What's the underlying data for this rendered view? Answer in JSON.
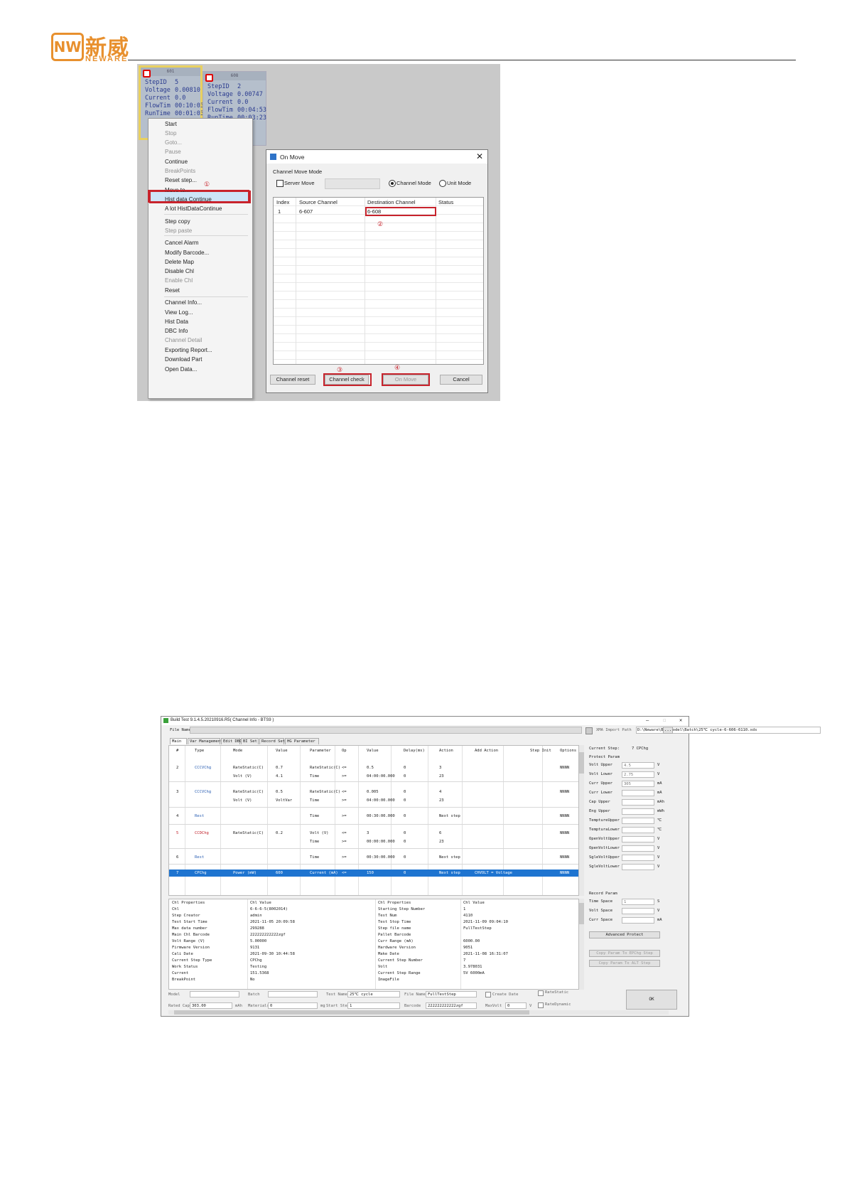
{
  "header": {
    "logo_mark": "NW",
    "logo_cn": "新威",
    "logo_en": "NEWARE"
  },
  "colors": {
    "brand": "#e8902e",
    "highlight": "#c8232c",
    "selection": "#1e74d0"
  },
  "shot1": {
    "tiles": [
      {
        "top": "601",
        "rows": [
          [
            "StepID",
            "5"
          ],
          [
            "Voltage",
            "0.00810"
          ],
          [
            "Current",
            "0.0"
          ],
          [
            "FlowTim",
            "00:10:03"
          ],
          [
            "RunTime",
            "00:01:03"
          ]
        ]
      },
      {
        "top": "608",
        "rows": [
          [
            "StepID",
            "2"
          ],
          [
            "Voltage",
            "0.00747"
          ],
          [
            "Current",
            "0.0"
          ],
          [
            "FlowTim",
            "00:04:53"
          ],
          [
            "RunTime",
            "00:03:23"
          ]
        ]
      }
    ],
    "menu": [
      {
        "label": "Start",
        "dis": false
      },
      {
        "label": "Stop",
        "dis": true
      },
      {
        "label": "Goto...",
        "dis": true
      },
      {
        "label": "Pause",
        "dis": true
      },
      {
        "label": "Continue",
        "dis": false
      },
      {
        "label": "BreakPoints",
        "dis": true
      },
      {
        "label": "Reset step...",
        "dis": false
      },
      {
        "label": "Move to...",
        "dis": false
      },
      {
        "label": "Hist data Continue",
        "dis": false
      },
      {
        "label": "A lot HistDataContinue",
        "dis": false
      },
      {
        "label": "Step copy",
        "dis": false
      },
      {
        "label": "Step paste",
        "dis": true
      },
      {
        "label": "Cancel Alarm",
        "dis": false
      },
      {
        "label": "Modify Barcode...",
        "dis": false
      },
      {
        "label": "Delete Map",
        "dis": false
      },
      {
        "label": "Disable Chl",
        "dis": false
      },
      {
        "label": "Enable Chl",
        "dis": true
      },
      {
        "label": "Reset",
        "dis": false
      },
      {
        "label": "Channel Info...",
        "dis": false
      },
      {
        "label": "View Log...",
        "dis": false
      },
      {
        "label": "Hist Data",
        "dis": false
      },
      {
        "label": "DBC Info",
        "dis": false
      },
      {
        "label": "Channel Detail",
        "dis": true
      },
      {
        "label": "Exporting Report...",
        "dis": false
      },
      {
        "label": "Download Part",
        "dis": false
      },
      {
        "label": "Open Data...",
        "dis": false
      }
    ],
    "markers": {
      "m1": "①",
      "m2": "②",
      "m3": "③",
      "m4": "④"
    },
    "dialog": {
      "title": "On Move",
      "close": "✕",
      "group": "Channel Move Mode",
      "server_move": "Server Move",
      "channel_mode": "Channel Mode",
      "unit_mode": "Unit Mode",
      "cols": [
        "Index",
        "Source Channel",
        "Destination Channel",
        "Status"
      ],
      "row": {
        "index": "1",
        "source": "6-607",
        "dest": "6-608",
        "status": ""
      },
      "buttons": {
        "reset": "Channel reset",
        "check": "Channel check",
        "move": "On Move",
        "cancel": "Cancel"
      }
    }
  },
  "shot2": {
    "title": "Build Test 9.1.4.5.20210916.R5( Channel Info - BTS9 )",
    "win_min": "—",
    "win_max": "☐",
    "win_close": "✕",
    "file_name_label": "File Name",
    "xml_label": "XMA Import Path",
    "xml_path": "D:\\Neware\\BDA\\Model\\Batch\\25℃ cycle-6-606-6110.xds",
    "browse": "...",
    "tabs": [
      "Main",
      "Var Management",
      "Edit DBC",
      "BI Set",
      "Record Set",
      "HG Parameter"
    ],
    "cols": [
      "#",
      "Type",
      "Mode",
      "Value",
      "Parameter",
      "Op",
      "Value",
      "Delay(ms)",
      "Action",
      "Add Action",
      "Step Init",
      "Options"
    ],
    "rows": [
      [
        "2",
        "CCCVChg",
        "RateStatic(C)",
        "0.7",
        "RateStatic(C)",
        "<=",
        "0.5",
        "0",
        "3",
        "",
        "",
        "NNNN"
      ],
      [
        "",
        "",
        "Volt (V)",
        "4.1",
        "Time",
        ">=",
        "04:00:00.000",
        "0",
        "23",
        "",
        "",
        ""
      ],
      [
        "3",
        "CCCVChg",
        "RateStatic(C)",
        "0.5",
        "RateStatic(C)",
        "<=",
        "0.005",
        "0",
        "4",
        "",
        "",
        "NNNN"
      ],
      [
        "",
        "",
        "Volt (V)",
        "VoltVar",
        "Time",
        ">=",
        "04:00:00.000",
        "0",
        "23",
        "",
        "",
        ""
      ],
      [
        "4",
        "Rest",
        "",
        "",
        "Time",
        ">=",
        "00:30:00.000",
        "0",
        "Next step",
        "",
        "",
        "NNNN"
      ],
      [
        "5",
        "CCDChg",
        "RateStatic(C)",
        "0.2",
        "Volt (V)",
        "<=",
        "3",
        "0",
        "6",
        "",
        "",
        "NNNN"
      ],
      [
        "",
        "",
        "",
        "",
        "Time",
        ">=",
        "00:00:00.000",
        "0",
        "23",
        "",
        "",
        ""
      ],
      [
        "6",
        "Rest",
        "",
        "",
        "Time",
        ">=",
        "00:30:00.000",
        "0",
        "Next step",
        "",
        "",
        "NNNN"
      ],
      [
        "7",
        "CPChg",
        "Power (mW)",
        "600",
        "Current (mA)",
        "<=",
        "150",
        "0",
        "Next step",
        "CHVOLT = Voltage",
        "",
        "NNNN"
      ]
    ],
    "right_panel": {
      "current_step_label": "Current Step:",
      "current_step_value": "7 CPChg",
      "protect_label": "Protect Param",
      "protect": [
        {
          "name": "Volt Upper",
          "val": "4.5",
          "unit": "V"
        },
        {
          "name": "Volt Lower",
          "val": "2.75",
          "unit": "V"
        },
        {
          "name": "Curr Upper",
          "val": "305",
          "unit": "mA"
        },
        {
          "name": "Curr Lower",
          "val": "",
          "unit": "mA"
        },
        {
          "name": "Cap Upper",
          "val": "",
          "unit": "mAh"
        },
        {
          "name": "Eng Upper",
          "val": "",
          "unit": "mWh"
        },
        {
          "name": "TemptureUpper",
          "val": "",
          "unit": "℃"
        },
        {
          "name": "TempturaLower",
          "val": "",
          "unit": "℃"
        },
        {
          "name": "OpenVoltUpper",
          "val": "",
          "unit": "V"
        },
        {
          "name": "OpenVoltLower",
          "val": "",
          "unit": "V"
        },
        {
          "name": "SgleVoltUpper",
          "val": "",
          "unit": "V"
        },
        {
          "name": "SgleVoltLower",
          "val": "",
          "unit": "V"
        }
      ],
      "record_label": "Record Param",
      "record": [
        {
          "name": "Time Space",
          "val": "1",
          "unit": "S"
        },
        {
          "name": "Volt Space",
          "val": "",
          "unit": "V"
        },
        {
          "name": "Curr Space",
          "val": "",
          "unit": "mA"
        }
      ],
      "adv_btn": "Advanced Protect",
      "copy_btn1": "Copy Param To EPChg Step",
      "copy_btn2": "Copy Param To ALT Step"
    },
    "props_header": [
      "Chl Properties",
      "Chl Value",
      "Chl Properties",
      "Chl Value"
    ],
    "props": [
      [
        "Chl",
        "6-6-6-5(8002014)",
        "Starting Step Number",
        "1"
      ],
      [
        "Step Creator",
        "admin",
        "Test Num",
        "4110"
      ],
      [
        "Test Start Time",
        "2021-11-05 20:09:58",
        "Test Stop Time",
        "2021-11-09 09:04:10"
      ],
      [
        "Max data number",
        "299288",
        "Step file name",
        "FullTestStep"
      ],
      [
        "Main Chl Barcode",
        "222222222222zgf",
        "Pallet Barcode",
        ""
      ],
      [
        "Volt Range (V)",
        "5.00000",
        "Curr Range (mA)",
        "6000.00"
      ],
      [
        "Firmware Version",
        "9131",
        "Hardware Version",
        "9051"
      ],
      [
        "Cali Date",
        "2021-09-30 10:44:58",
        "Make Date",
        "2021-11-08 16:31:07"
      ],
      [
        "Current Step Type",
        "CPChg",
        "Current Step Number",
        "7"
      ],
      [
        "Work Status",
        "Testing",
        "Volt",
        "3.978031"
      ],
      [
        "Current",
        "151.5368",
        "Current Step Range",
        "5V 6000mA"
      ],
      [
        "BreakPoint",
        "No",
        "ImageFile",
        ""
      ]
    ],
    "bottom": {
      "model": "Model",
      "batch": "Batch",
      "test_name": "Test Name",
      "test_name_val": "25℃ cycle",
      "file_name": "File Name",
      "file_name_val": "FullTestStep",
      "create_date": "Create Date",
      "rate_static": "RateStatic",
      "rated_cap": "Rated Cap",
      "rated_cap_val": "303.00",
      "rated_cap_unit": "mAh",
      "materials": "Materials",
      "materials_val": "0",
      "materials_unit": "mg",
      "start_step": "Start Step",
      "start_step_val": "1",
      "barcode": "Barcode",
      "barcode_val": "222222222222zgf",
      "max_volt": "MaxVolt",
      "max_volt_val": "0",
      "max_volt_unit": "V",
      "rate_dynamic": "RateDynamic",
      "ok": "OK"
    }
  }
}
